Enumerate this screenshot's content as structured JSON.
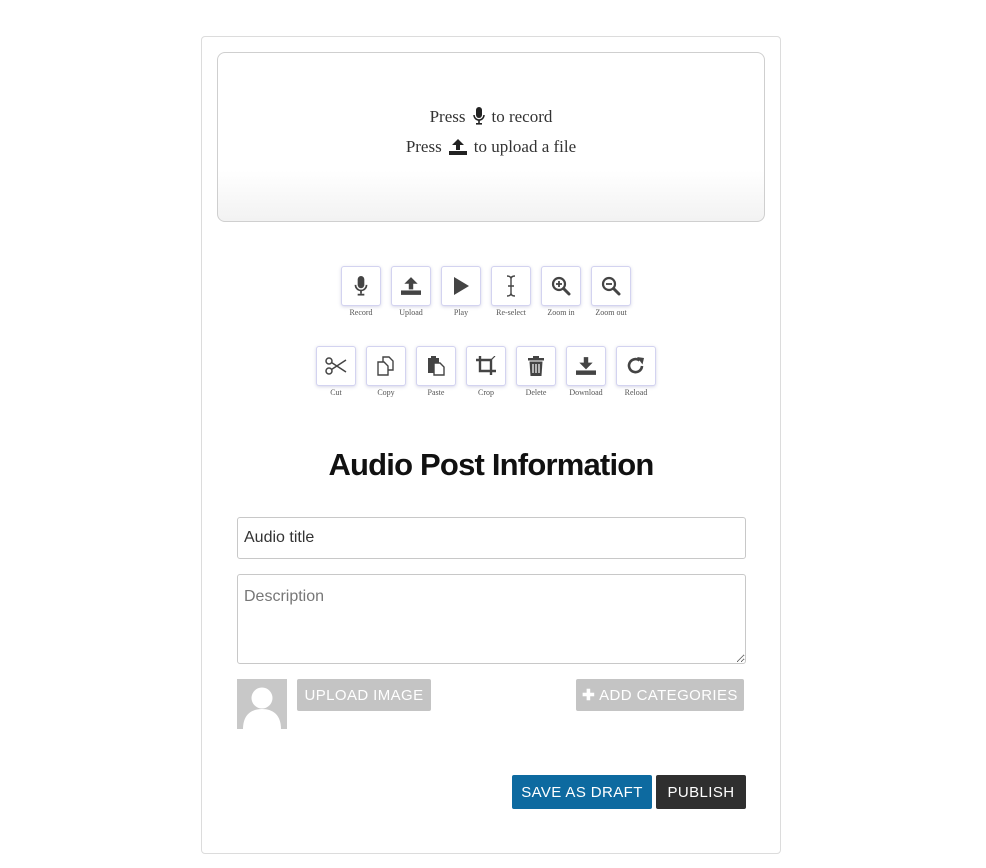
{
  "recorder": {
    "prompt_record_prefix": "Press",
    "prompt_record_suffix": "to record",
    "prompt_upload_prefix": "Press",
    "prompt_upload_suffix": "to upload a file"
  },
  "toolbar_row1": [
    {
      "label": "Record",
      "icon": "microphone-icon"
    },
    {
      "label": "Upload",
      "icon": "upload-icon"
    },
    {
      "label": "Play",
      "icon": "play-icon"
    },
    {
      "label": "Re-select",
      "icon": "text-cursor-icon"
    },
    {
      "label": "Zoom in",
      "icon": "zoom-in-icon"
    },
    {
      "label": "Zoom out",
      "icon": "zoom-out-icon"
    }
  ],
  "toolbar_row2": [
    {
      "label": "Cut",
      "icon": "scissors-icon"
    },
    {
      "label": "Copy",
      "icon": "copy-icon"
    },
    {
      "label": "Paste",
      "icon": "paste-icon"
    },
    {
      "label": "Crop",
      "icon": "crop-icon"
    },
    {
      "label": "Delete",
      "icon": "trash-icon"
    },
    {
      "label": "Download",
      "icon": "download-icon"
    },
    {
      "label": "Reload",
      "icon": "reload-icon"
    }
  ],
  "form": {
    "heading": "Audio Post Information",
    "title_value": "Audio title",
    "description_placeholder": "Description",
    "upload_image_label": "UPLOAD IMAGE",
    "add_categories_label": "ADD CATEGORIES",
    "save_draft_label": "SAVE AS DRAFT",
    "publish_label": "PUBLISH"
  },
  "colors": {
    "save_draft_bg": "#0d6aa0",
    "publish_bg": "#2f2f2f",
    "gray_button_bg": "#c4c4c4",
    "icon_color": "#444444"
  }
}
